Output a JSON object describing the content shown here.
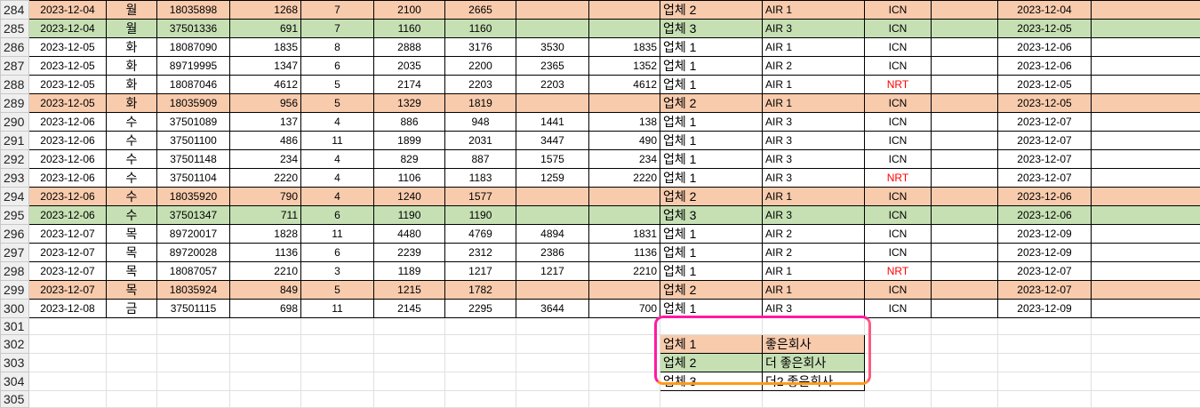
{
  "rows": [
    {
      "num": "284",
      "date": "2023-12-04",
      "day": "월",
      "code": "18035898",
      "qty": "1268",
      "cnt": "7",
      "p1": "2100",
      "p2": "2665",
      "p3": "",
      "p4": "",
      "vendor": "업체 2",
      "air": "AIR 1",
      "port": "ICN",
      "port_red": false,
      "date2": "2023-12-04",
      "fill": "orange"
    },
    {
      "num": "285",
      "date": "2023-12-04",
      "day": "월",
      "code": "37501336",
      "qty": "691",
      "cnt": "7",
      "p1": "1160",
      "p2": "1160",
      "p3": "",
      "p4": "",
      "vendor": "업체 3",
      "air": "AIR 3",
      "port": "ICN",
      "port_red": false,
      "date2": "2023-12-05",
      "fill": "green"
    },
    {
      "num": "286",
      "date": "2023-12-05",
      "day": "화",
      "code": "18087090",
      "qty": "1835",
      "cnt": "8",
      "p1": "2888",
      "p2": "3176",
      "p3": "3530",
      "p4": "1835",
      "vendor": "업체 1",
      "air": "AIR 1",
      "port": "ICN",
      "port_red": false,
      "date2": "2023-12-06",
      "fill": "none"
    },
    {
      "num": "287",
      "date": "2023-12-05",
      "day": "화",
      "code": "89719995",
      "qty": "1347",
      "cnt": "6",
      "p1": "2035",
      "p2": "2200",
      "p3": "2365",
      "p4": "1352",
      "vendor": "업체 1",
      "air": "AIR 2",
      "port": "ICN",
      "port_red": false,
      "date2": "2023-12-06",
      "fill": "none"
    },
    {
      "num": "288",
      "date": "2023-12-05",
      "day": "화",
      "code": "18087046",
      "qty": "4612",
      "cnt": "5",
      "p1": "2174",
      "p2": "2203",
      "p3": "2203",
      "p4": "4612",
      "vendor": "업체 1",
      "air": "AIR 1",
      "port": "NRT",
      "port_red": true,
      "date2": "2023-12-05",
      "fill": "none"
    },
    {
      "num": "289",
      "date": "2023-12-05",
      "day": "화",
      "code": "18035909",
      "qty": "956",
      "cnt": "5",
      "p1": "1329",
      "p2": "1819",
      "p3": "",
      "p4": "",
      "vendor": "업체 2",
      "air": "AIR 1",
      "port": "ICN",
      "port_red": false,
      "date2": "2023-12-05",
      "fill": "orange"
    },
    {
      "num": "290",
      "date": "2023-12-06",
      "day": "수",
      "code": "37501089",
      "qty": "137",
      "cnt": "4",
      "p1": "886",
      "p2": "948",
      "p3": "1441",
      "p4": "138",
      "vendor": "업체 1",
      "air": "AIR 3",
      "port": "ICN",
      "port_red": false,
      "date2": "2023-12-07",
      "fill": "none"
    },
    {
      "num": "291",
      "date": "2023-12-06",
      "day": "수",
      "code": "37501100",
      "qty": "486",
      "cnt": "11",
      "p1": "1899",
      "p2": "2031",
      "p3": "3447",
      "p4": "490",
      "vendor": "업체 1",
      "air": "AIR 3",
      "port": "ICN",
      "port_red": false,
      "date2": "2023-12-07",
      "fill": "none"
    },
    {
      "num": "292",
      "date": "2023-12-06",
      "day": "수",
      "code": "37501148",
      "qty": "234",
      "cnt": "4",
      "p1": "829",
      "p2": "887",
      "p3": "1575",
      "p4": "234",
      "vendor": "업체 1",
      "air": "AIR 3",
      "port": "ICN",
      "port_red": false,
      "date2": "2023-12-07",
      "fill": "none"
    },
    {
      "num": "293",
      "date": "2023-12-06",
      "day": "수",
      "code": "37501104",
      "qty": "2220",
      "cnt": "4",
      "p1": "1106",
      "p2": "1183",
      "p3": "1259",
      "p4": "2220",
      "vendor": "업체 1",
      "air": "AIR 3",
      "port": "NRT",
      "port_red": true,
      "date2": "2023-12-07",
      "fill": "none"
    },
    {
      "num": "294",
      "date": "2023-12-06",
      "day": "수",
      "code": "18035920",
      "qty": "790",
      "cnt": "4",
      "p1": "1240",
      "p2": "1577",
      "p3": "",
      "p4": "",
      "vendor": "업체 2",
      "air": "AIR 1",
      "port": "ICN",
      "port_red": false,
      "date2": "2023-12-06",
      "fill": "orange"
    },
    {
      "num": "295",
      "date": "2023-12-06",
      "day": "수",
      "code": "37501347",
      "qty": "711",
      "cnt": "6",
      "p1": "1190",
      "p2": "1190",
      "p3": "",
      "p4": "",
      "vendor": "업체 3",
      "air": "AIR 3",
      "port": "ICN",
      "port_red": false,
      "date2": "2023-12-06",
      "fill": "green"
    },
    {
      "num": "296",
      "date": "2023-12-07",
      "day": "목",
      "code": "89720017",
      "qty": "1828",
      "cnt": "11",
      "p1": "4480",
      "p2": "4769",
      "p3": "4894",
      "p4": "1831",
      "vendor": "업체 1",
      "air": "AIR 2",
      "port": "ICN",
      "port_red": false,
      "date2": "2023-12-09",
      "fill": "none"
    },
    {
      "num": "297",
      "date": "2023-12-07",
      "day": "목",
      "code": "89720028",
      "qty": "1136",
      "cnt": "6",
      "p1": "2239",
      "p2": "2312",
      "p3": "2386",
      "p4": "1136",
      "vendor": "업체 1",
      "air": "AIR 2",
      "port": "ICN",
      "port_red": false,
      "date2": "2023-12-09",
      "fill": "none"
    },
    {
      "num": "298",
      "date": "2023-12-07",
      "day": "목",
      "code": "18087057",
      "qty": "2210",
      "cnt": "3",
      "p1": "1189",
      "p2": "1217",
      "p3": "1217",
      "p4": "2210",
      "vendor": "업체 1",
      "air": "AIR 1",
      "port": "NRT",
      "port_red": true,
      "date2": "2023-12-07",
      "fill": "none"
    },
    {
      "num": "299",
      "date": "2023-12-07",
      "day": "목",
      "code": "18035924",
      "qty": "849",
      "cnt": "5",
      "p1": "1215",
      "p2": "1782",
      "p3": "",
      "p4": "",
      "vendor": "업체 2",
      "air": "AIR 1",
      "port": "ICN",
      "port_red": false,
      "date2": "2023-12-07",
      "fill": "orange"
    },
    {
      "num": "300",
      "date": "2023-12-08",
      "day": "금",
      "code": "37501115",
      "qty": "698",
      "cnt": "11",
      "p1": "2145",
      "p2": "2295",
      "p3": "3644",
      "p4": "700",
      "vendor": "업체 1",
      "air": "AIR 3",
      "port": "ICN",
      "port_red": false,
      "date2": "2023-12-09",
      "fill": "none"
    }
  ],
  "empty_rows": [
    "301",
    "302",
    "303",
    "304",
    "305"
  ],
  "legend": [
    {
      "row": "302",
      "vendor": "업체 1",
      "company": "좋은회사",
      "fill": "orange"
    },
    {
      "row": "303",
      "vendor": "업체 2",
      "company": "더 좋은회사",
      "fill": "green"
    },
    {
      "row": "304",
      "vendor": "업체 3",
      "company": "더2 좋은회사",
      "fill": "none"
    }
  ],
  "colors": {
    "orange": "#f8cbad",
    "green": "#c6e0b4",
    "red": "#ff0000",
    "frame_top": "#ff1aa0",
    "frame_bottom": "#ff9a1a"
  }
}
